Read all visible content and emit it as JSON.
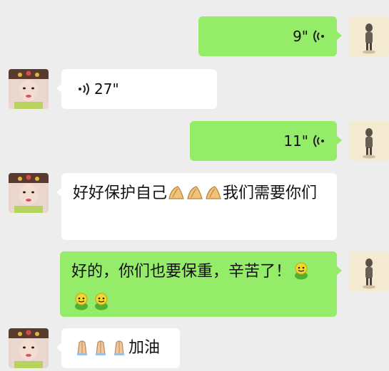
{
  "messages": [
    {
      "side": "out",
      "type": "voice",
      "duration": "9\""
    },
    {
      "side": "in",
      "type": "voice",
      "duration": "27\""
    },
    {
      "side": "out",
      "type": "voice",
      "duration": "11\""
    },
    {
      "side": "in",
      "type": "text",
      "parts": [
        "好好保护自己",
        "我们需要你们"
      ],
      "emoji": "clap-hands-icon ×3"
    },
    {
      "side": "out",
      "type": "text",
      "text": "好的，你们也要保重，辛苦了！",
      "emoji": "green-smiley-icon ×3"
    },
    {
      "side": "in",
      "type": "text",
      "text": "加油",
      "emoji": "praying-hands-icon ×3"
    }
  ],
  "colors": {
    "background": "#ededed",
    "outgoing": "#95ec69",
    "incoming": "#ffffff"
  }
}
